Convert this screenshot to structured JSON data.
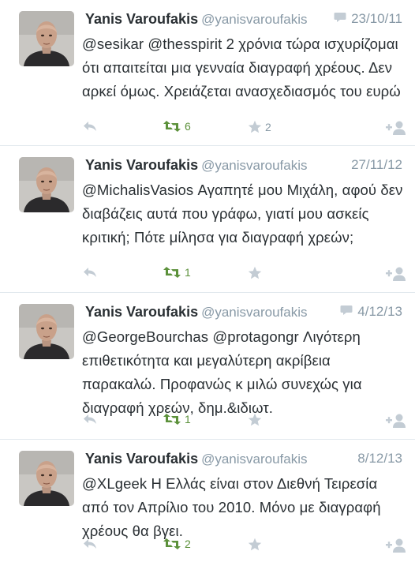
{
  "colors": {
    "name": "#292f33",
    "muted": "#8899a6",
    "retweet": "#5c913b",
    "divider": "#e1e8ed"
  },
  "tweets": [
    {
      "name": "Yanis Varoufakis",
      "handle": "@yanisvaroufakis",
      "date": "23/10/11",
      "has_reply_bubble": true,
      "text": "@sesikar @thesspirit 2 χρόνια τώρα ισχυρίζομαι ότι απαιτείται μια γενναία διαγραφή χρέους. Δεν αρκεί όμως. Χρειάζεται ανασχεδιασμός του ευρώ",
      "retweets": "6",
      "favorites": "2"
    },
    {
      "name": "Yanis Varoufakis",
      "handle": "@yanisvaroufakis",
      "date": "27/11/12",
      "has_reply_bubble": false,
      "text": "@MichalisVasios Αγαπητέ μου Μιχάλη, αφού δεν διαβάζεις αυτά που γράφω, γιατί μου ασκείς κριτική; Πότε μίλησα για διαγραφή χρεών;",
      "retweets": "1",
      "favorites": ""
    },
    {
      "name": "Yanis Varoufakis",
      "handle": "@yanisvaroufakis",
      "date": "4/12/13",
      "has_reply_bubble": true,
      "text": "@GeorgeBourchas @protagongr Λιγότερη επιθετικότητα και μεγαλύτερη ακρίβεια παρακαλώ. Προφανώς κ μιλώ συνεχώς για διαγραφή χρεών, δημ.&ιδιωτ.",
      "retweets": "1",
      "favorites": ""
    },
    {
      "name": "Yanis Varoufakis",
      "handle": "@yanisvaroufakis",
      "date": "8/12/13",
      "has_reply_bubble": false,
      "text": "@XLgeek Η Ελλάς είναι στον Διεθνή Τειρεσία από τον Απρίλιο του 2010. Μόνο με διαγραφή χρέους θα βγει.",
      "retweets": "2",
      "favorites": ""
    }
  ]
}
